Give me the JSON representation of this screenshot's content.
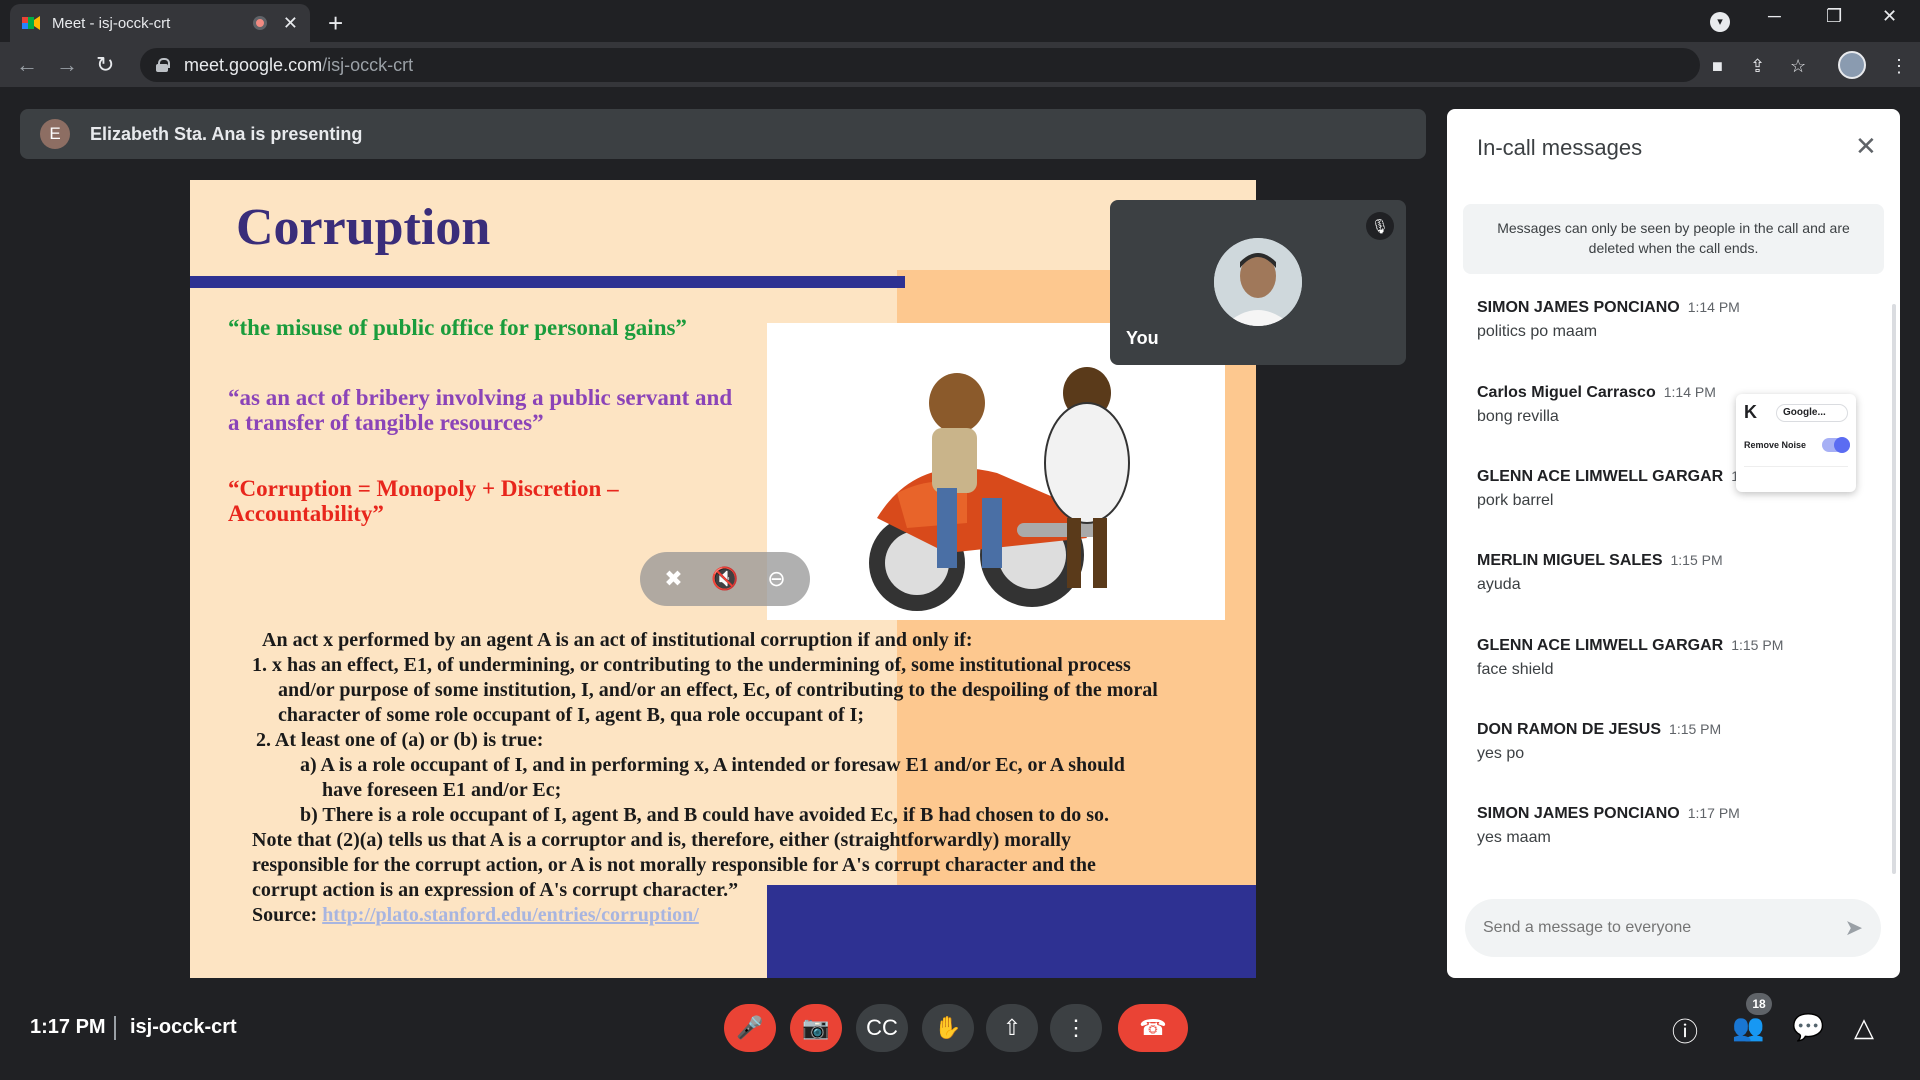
{
  "browser": {
    "tab_title": "Meet - isj-occk-crt",
    "url_host": "meet.google.com",
    "url_path": "/isj-occk-crt"
  },
  "presenter": {
    "initial": "E",
    "text": "Elizabeth Sta. Ana is presenting"
  },
  "slide": {
    "title": "Corruption",
    "quote1": "“the misuse of public office for personal gains”",
    "quote2": "“as an act of bribery involving a public servant and a transfer of tangible resources”",
    "quote3": "“Corruption = Monopoly + Discretion – Accountability”",
    "body": [
      "An act x performed by an agent A is an act of institutional corruption if and only if:",
      "1.  x has an effect, E1, of undermining, or contributing to the undermining of, some institutional process",
      "and/or purpose of some institution, I, and/or an effect, Ec, of contributing to the despoiling of the moral",
      "character of some role occupant of I, agent B, qua role occupant of I;",
      "2.  At least one of (a) or (b) is true:",
      "a)  A is a role occupant of I, and in performing x, A intended or foresaw E1 and/or Ec, or A should",
      "have foreseen E1 and/or Ec;",
      "b)  There is a role occupant of I, agent B, and B could have avoided Ec, if B had chosen to do so.",
      "Note that (2)(a) tells us that A is a corruptor and is, therefore, either (straightforwardly) morally",
      "responsible for the corrupt action, or A is not morally responsible for A's corrupt character and the",
      "corrupt action is an expression of A's corrupt character.”"
    ],
    "source_label": "Source: ",
    "source_link": "http://plato.stanford.edu/entries/corruption/"
  },
  "self_tile": {
    "label": "You"
  },
  "panel": {
    "title": "In-call messages",
    "notice": "Messages can only be seen by people in the call and are deleted when the call ends.",
    "messages": [
      {
        "sender": "SIMON JAMES PONCIANO",
        "time": "1:14 PM",
        "text": "politics po maam"
      },
      {
        "sender": "Carlos Miguel Carrasco",
        "time": "1:14 PM",
        "text": "bong revilla"
      },
      {
        "sender": "GLENN ACE LIMWELL GARGAR",
        "time": "1:1",
        "text": "pork barrel"
      },
      {
        "sender": "MERLIN MIGUEL SALES",
        "time": "1:15 PM",
        "text": "ayuda"
      },
      {
        "sender": "GLENN ACE LIMWELL GARGAR",
        "time": "1:15 PM",
        "text": "face shield"
      },
      {
        "sender": "DON RAMON DE JESUS",
        "time": "1:15 PM",
        "text": "yes po"
      },
      {
        "sender": "SIMON JAMES PONCIANO",
        "time": "1:17 PM",
        "text": "yes maam"
      }
    ],
    "composer_placeholder": "Send a message to everyone"
  },
  "krisp": {
    "tab_label": "Google...",
    "remove_noise": "Remove Noise"
  },
  "bottom": {
    "time": "1:17 PM",
    "meeting_code": "isj-occk-crt",
    "participant_count": "18"
  }
}
